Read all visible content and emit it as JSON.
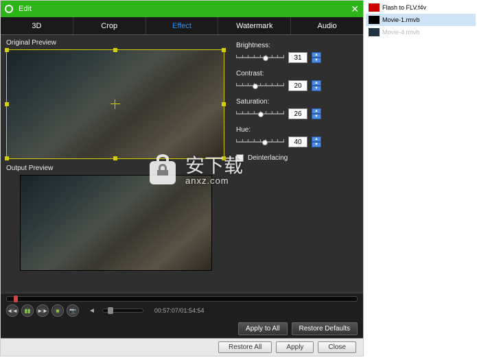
{
  "titlebar": {
    "title": "Edit"
  },
  "tabs": [
    "3D",
    "Crop",
    "Effect",
    "Watermark",
    "Audio"
  ],
  "activeTab": 2,
  "labels": {
    "original": "Original Preview",
    "output": "Output Preview"
  },
  "effects": {
    "brightness": {
      "label": "Brightness:",
      "value": "31",
      "pct": 62
    },
    "contrast": {
      "label": "Contrast:",
      "value": "20",
      "pct": 40
    },
    "saturation": {
      "label": "Saturation:",
      "value": "26",
      "pct": 52
    },
    "hue": {
      "label": "Hue:",
      "value": "40",
      "pct": 60
    },
    "deinterlace_label": "Deinterlacing"
  },
  "player": {
    "time": "00:57:07/01:54:54"
  },
  "actions": {
    "apply_all": "Apply to All",
    "restore_defaults": "Restore Defaults",
    "restore_all": "Restore All",
    "apply": "Apply",
    "close": "Close"
  },
  "files": [
    {
      "name": "Flash to FLV.f4v",
      "selected": false,
      "kind": "flash"
    },
    {
      "name": "Movie-1.rmvb",
      "selected": true,
      "kind": "dark"
    },
    {
      "name": "Movie-4.rmvb",
      "selected": false,
      "kind": "dark"
    }
  ],
  "watermark": {
    "text": "安下载",
    "sub": "anxz.com"
  }
}
